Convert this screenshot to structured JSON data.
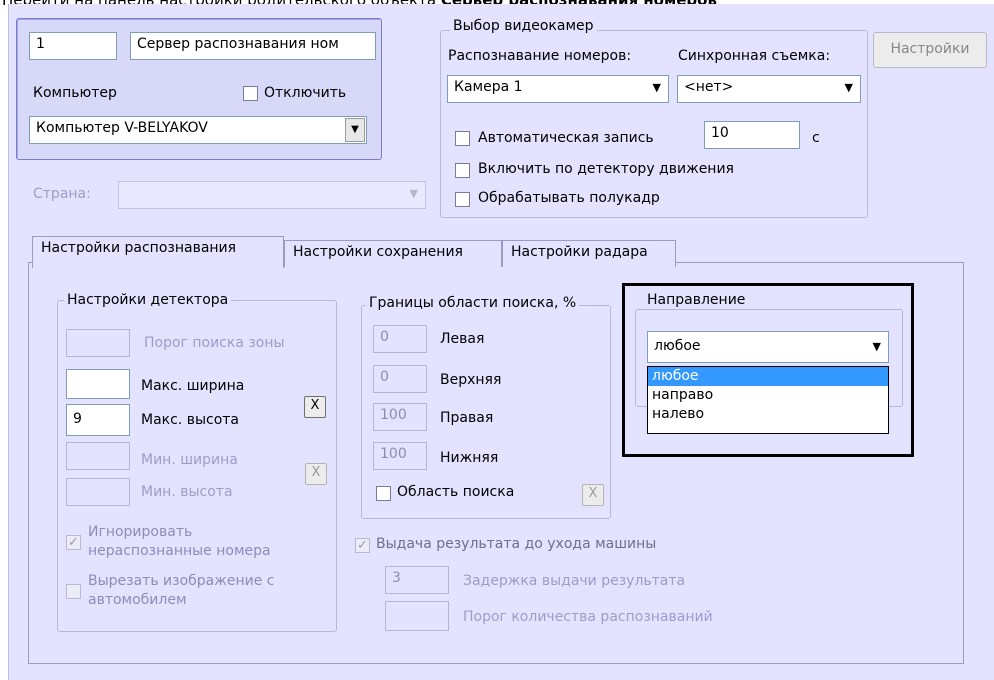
{
  "doc": {
    "prefix": "Перейти на панель настройки родительского объекта ",
    "bold": "Сервер распознавания номеров"
  },
  "server": {
    "id": "1",
    "name": "Сервер распознавания ном",
    "computer_label": "Компьютер",
    "disable_label": "Отключить",
    "computer_value": "Компьютер V-BELYAKOV",
    "country_label": "Страна:",
    "country_value": ""
  },
  "cameras": {
    "legend": "Выбор видеокамер",
    "recognition_label": "Распознавание номеров:",
    "sync_label": "Синхронная съемка:",
    "recognition_value": "Камера 1",
    "sync_value": "<нет>",
    "autorecord_label": "Автоматическая запись",
    "autorecord_value": "10",
    "autorecord_unit": "с",
    "motion_label": "Включить по детектору движения",
    "halfframe_label": "Обрабатывать полукадр",
    "settings_button": "Настройки"
  },
  "tabs": [
    {
      "label": "Настройки распознавания"
    },
    {
      "label": "Настройки сохранения"
    },
    {
      "label": "Настройки радара"
    }
  ],
  "detector": {
    "legend": "Настройки детектора",
    "zone_threshold_label": "Порог поиска зоны",
    "zone_threshold_value": "",
    "max_width_label": "Макс. ширина",
    "max_width_value": "",
    "max_height_label": "Макс. высота",
    "max_height_value": "9",
    "min_width_label": "Мин. ширина",
    "min_width_value": "",
    "min_height_label": "Мин. высота",
    "min_height_value": "",
    "x_label": "X",
    "ignore_label_1": "Игнорировать",
    "ignore_label_2": "нераспознанные номера",
    "crop_label_1": "Вырезать изображение с",
    "crop_label_2": "автомобилем"
  },
  "bounds": {
    "legend": "Границы области поиска, %",
    "left_label": "Левая",
    "left_value": "0",
    "top_label": "Верхняя",
    "top_value": "0",
    "right_label": "Правая",
    "right_value": "100",
    "bottom_label": "Нижняя",
    "bottom_value": "100",
    "area_label": "Область поиска",
    "x_label": "X"
  },
  "output": {
    "early_label": "Выдача результата до ухода машины",
    "delay_value": "3",
    "delay_label": "Задержка выдачи результата",
    "count_value": "",
    "count_label": "Порог количества распознаваний"
  },
  "direction": {
    "legend": "Направление",
    "value": "любое",
    "options": [
      "любое",
      "направо",
      "налево"
    ]
  },
  "colors": {
    "panel": "#e3e3ff",
    "highlight": "#3399ff"
  }
}
